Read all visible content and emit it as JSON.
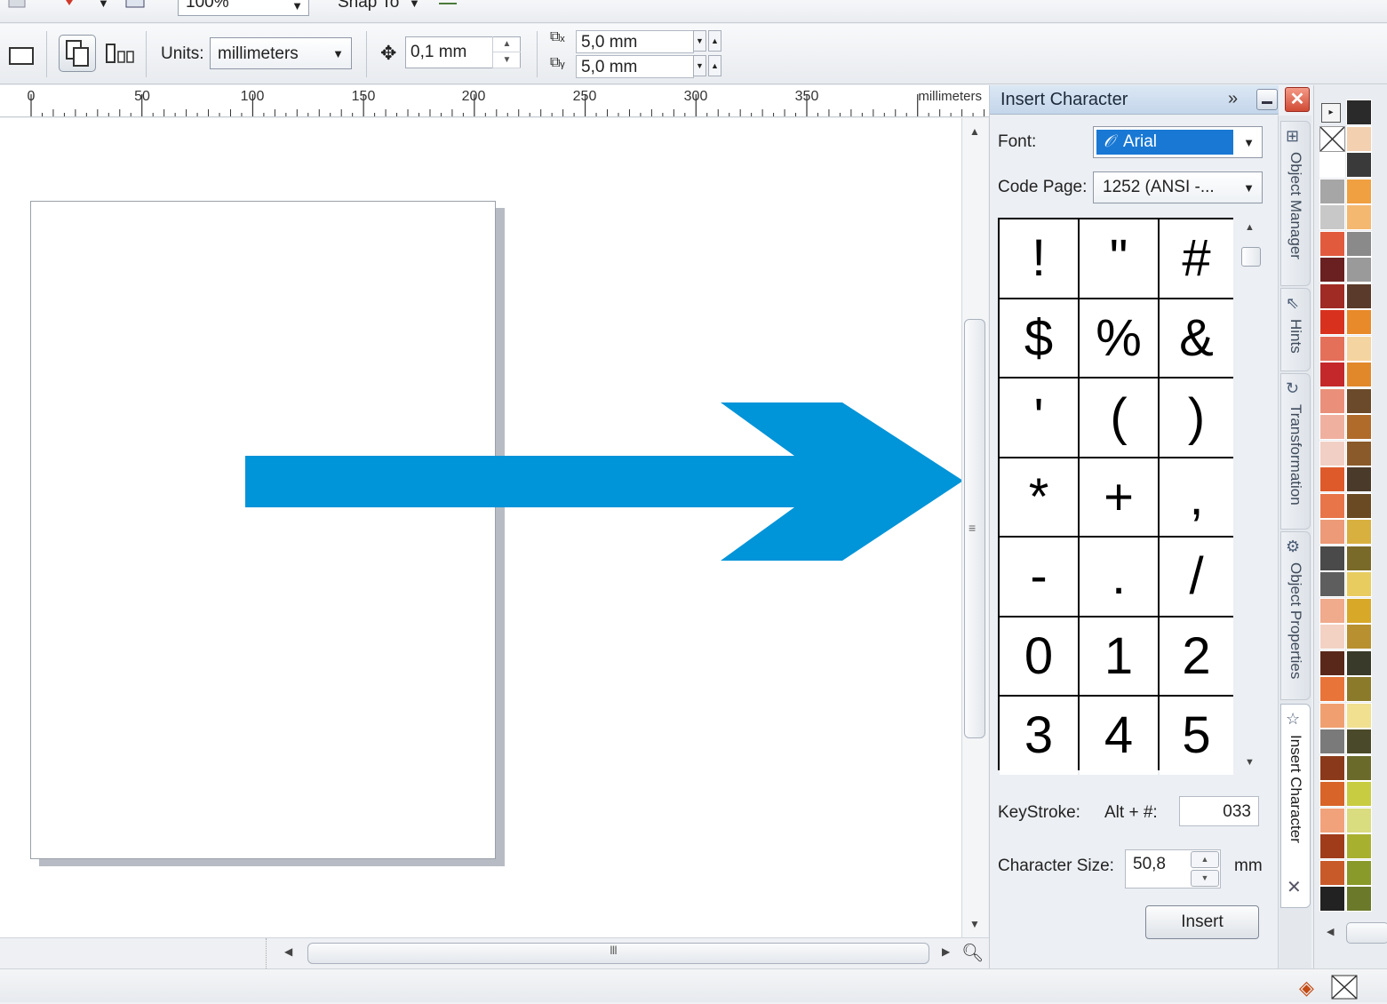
{
  "toolbar_top": {
    "zoom_level": "100%",
    "snap_label": "Snap To"
  },
  "propbar": {
    "units_label": "Units:",
    "units_value": "millimeters",
    "nudge_value": "0,1 mm",
    "dup_x": "5,0 mm",
    "dup_y": "5,0 mm"
  },
  "ruler": {
    "labels": [
      "0",
      "50",
      "100",
      "150",
      "200",
      "250",
      "300",
      "350"
    ],
    "units": "millimeters"
  },
  "docker": {
    "title": "Insert Character",
    "font_label": "Font:",
    "font_value": "Arial",
    "codepage_label": "Code Page:",
    "codepage_value": "1252  (ANSI -...",
    "characters": [
      "!",
      "\"",
      "#",
      "$",
      "%",
      "&",
      "'",
      "(",
      ")",
      "*",
      "+",
      ",",
      "-",
      ".",
      "/",
      "0",
      "1",
      "2",
      "3",
      "4",
      "5"
    ],
    "keystroke_label": "KeyStroke:",
    "alt_label": "Alt + #:",
    "keystroke_value": "033",
    "charsize_label": "Character Size:",
    "charsize_value": "50,8",
    "charsize_unit": "mm",
    "insert_label": "Insert"
  },
  "docker_tabs": [
    {
      "label": "Object Manager",
      "icon": "object-manager-icon"
    },
    {
      "label": "Hints",
      "icon": "hints-icon"
    },
    {
      "label": "Transformation",
      "icon": "transformation-icon"
    },
    {
      "label": "Object Properties",
      "icon": "object-properties-icon"
    },
    {
      "label": "Insert Character",
      "icon": "star-icon"
    }
  ],
  "shape": {
    "fill_color": "#0094d8"
  },
  "palette": {
    "columns": [
      [
        "#000000",
        "#f5d0b0",
        "#ffffff",
        "#a6a6a6",
        "#c8c8c8",
        "#e15a3e",
        "#6a2020",
        "#a02a24",
        "#d8321f",
        "#e4705a",
        "#c4282a",
        "#ea907a",
        "#f0b0a0",
        "#f2cfc4",
        "#de5a2a",
        "#e8744a",
        "#ec9a78",
        "#4a4a4a",
        "#5e5e5e",
        "#f0aa8c",
        "#f3d2c4",
        "#5a281a",
        "#e8743a",
        "#f0a070",
        "#7a7a7a",
        "#8a3a1a",
        "#d8642a",
        "#f2a27a",
        "#a03c1a",
        "#c85a2a",
        "#222222"
      ],
      [
        "#2a2a2a",
        "#f2d0b0",
        "#3a3a3a",
        "#f0a040",
        "#f4b870",
        "#8a8a8a",
        "#9a9a9a",
        "#5a3a2a",
        "#e88a2a",
        "#f4d4a0",
        "#e0882a",
        "#6a4a2a",
        "#b06a2a",
        "#8a5a2a",
        "#4a3a2a",
        "#6a4a22",
        "#d8b040",
        "#7a6a2a",
        "#e8cc60",
        "#d8a828",
        "#b89030",
        "#3a3a2a",
        "#8a7a2a",
        "#f0e090",
        "#4a4a2a",
        "#6a6a2a",
        "#c8cc40",
        "#dadc80",
        "#a8b030",
        "#8a9a2a",
        "#6a7a2a"
      ]
    ]
  }
}
